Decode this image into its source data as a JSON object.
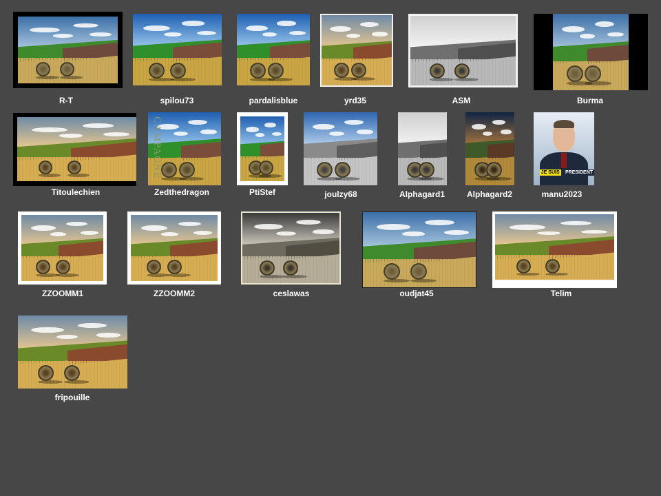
{
  "gallery": {
    "items": [
      {
        "label": "R-T",
        "variant": "color"
      },
      {
        "label": "spilou73",
        "variant": "vivid"
      },
      {
        "label": "pardalisblue",
        "variant": "vivid"
      },
      {
        "label": "yrd35",
        "variant": "warm"
      },
      {
        "label": "ASM",
        "variant": "bw"
      },
      {
        "label": "Burma",
        "variant": "color"
      },
      {
        "label": "Titoulechien",
        "variant": "warm"
      },
      {
        "label": "Zedthedragon",
        "variant": "vivid",
        "side_text": "CAMPAGNE"
      },
      {
        "label": "PtiStef",
        "variant": "vivid"
      },
      {
        "label": "joulzy68",
        "variant": "bw-sky"
      },
      {
        "label": "Alphagard1",
        "variant": "bw"
      },
      {
        "label": "Alphagard2",
        "variant": "dusk"
      },
      {
        "label": "manu2023",
        "variant": "portrait",
        "badge_left": "JE SUIS",
        "badge_right": "PRESIDENT"
      },
      {
        "label": "ZZOOMM1",
        "variant": "warm"
      },
      {
        "label": "ZZOOMM2",
        "variant": "warm"
      },
      {
        "label": "ceslawas",
        "variant": "sepia"
      },
      {
        "label": "oudjat45",
        "variant": "color"
      },
      {
        "label": "Telim",
        "variant": "warm"
      },
      {
        "label": "fripouille",
        "variant": "warm"
      }
    ]
  },
  "colors": {
    "background": "#474747",
    "label": "#ffffff"
  }
}
